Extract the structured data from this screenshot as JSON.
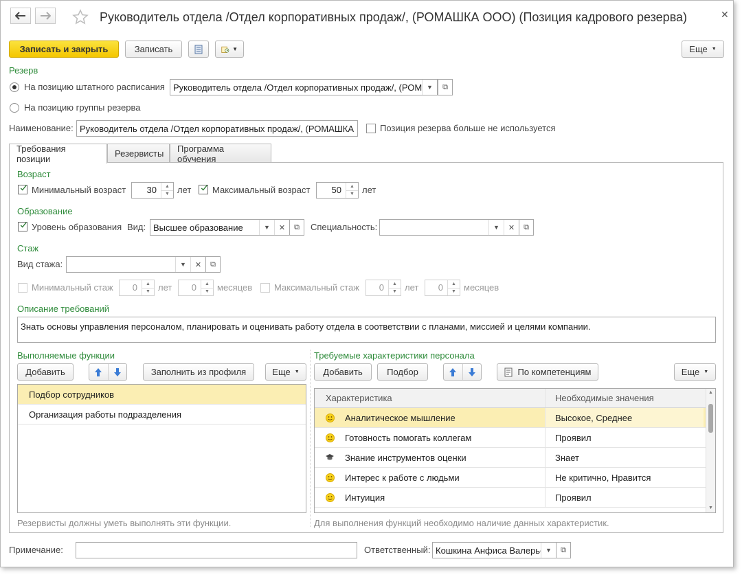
{
  "window": {
    "title": "Руководитель отдела /Отдел корпоративных продаж/, (РОМАШКА ООО) (Позиция кадрового резерва)"
  },
  "toolbar": {
    "save_close": "Записать и закрыть",
    "save": "Записать",
    "more": "Еще"
  },
  "reserve": {
    "section": "Резерв",
    "radio_staff": "На позицию штатного расписания",
    "radio_group": "На позицию группы резерва",
    "staff_value": "Руководитель отдела /Отдел корпоративных продаж/, (РОМ",
    "name_label": "Наименование:",
    "name_value": "Руководитель отдела /Отдел корпоративных продаж/, (РОМАШКА",
    "unused_label": "Позиция резерва больше не используется"
  },
  "tabs": [
    {
      "label": "Требования позиции"
    },
    {
      "label": "Резервисты"
    },
    {
      "label": "Программа обучения"
    }
  ],
  "age": {
    "section": "Возраст",
    "min_label": "Минимальный возраст",
    "min_value": "30",
    "min_unit": "лет",
    "max_label": "Максимальный возраст",
    "max_value": "50",
    "max_unit": "лет"
  },
  "education": {
    "section": "Образование",
    "level_label": "Уровень образования",
    "kind_label": "Вид:",
    "kind_value": "Высшее образование",
    "spec_label": "Специальность:",
    "spec_value": ""
  },
  "experience": {
    "section": "Стаж",
    "kind_label": "Вид стажа:",
    "kind_value": "",
    "min_label": "Минимальный стаж",
    "min_years": "0",
    "years_unit": "лет",
    "min_months": "0",
    "months_unit": "месяцев",
    "max_label": "Максимальный стаж",
    "max_years": "0",
    "max_years_unit": "лет",
    "max_months": "0",
    "max_months_unit": "месяцев"
  },
  "description": {
    "section": "Описание требований",
    "text": "Знать основы управления персоналом, планировать и оценивать работу отдела в соответствии с планами, миссией и целями компании."
  },
  "functions": {
    "section": "Выполняемые функции",
    "add": "Добавить",
    "fill": "Заполнить из профиля",
    "more": "Еще",
    "items": [
      {
        "label": "Подбор сотрудников"
      },
      {
        "label": "Организация работы подразделения"
      }
    ],
    "hint": "Резервисты должны уметь выполнять эти функции."
  },
  "characteristics": {
    "section": "Требуемые характеристики персонала",
    "add": "Добавить",
    "pick": "Подбор",
    "by_comp": "По компетенциям",
    "more": "Еще",
    "col1": "Характеристика",
    "col2": "Необходимые значения",
    "rows": [
      {
        "icon": "smiley-icon",
        "name": "Аналитическое мышление",
        "value": "Высокое, Среднее"
      },
      {
        "icon": "smiley-icon",
        "name": "Готовность помогать коллегам",
        "value": "Проявил"
      },
      {
        "icon": "graduation-cap-icon",
        "name": "Знание инструментов оценки",
        "value": "Знает"
      },
      {
        "icon": "smiley-icon",
        "name": "Интерес к работе с людьми",
        "value": "Не критично, Нравится"
      },
      {
        "icon": "smiley-icon",
        "name": "Интуиция",
        "value": "Проявил"
      }
    ],
    "hint": "Для выполнения функций необходимо наличие данных характеристик."
  },
  "footer": {
    "note_label": "Примечание:",
    "note_value": "",
    "resp_label": "Ответственный:",
    "resp_value": "Кошкина Анфиса Валерье"
  },
  "colors": {
    "accent": "#f4c600",
    "section": "#2e8b3a",
    "selected_row": "#fbeeb3"
  }
}
